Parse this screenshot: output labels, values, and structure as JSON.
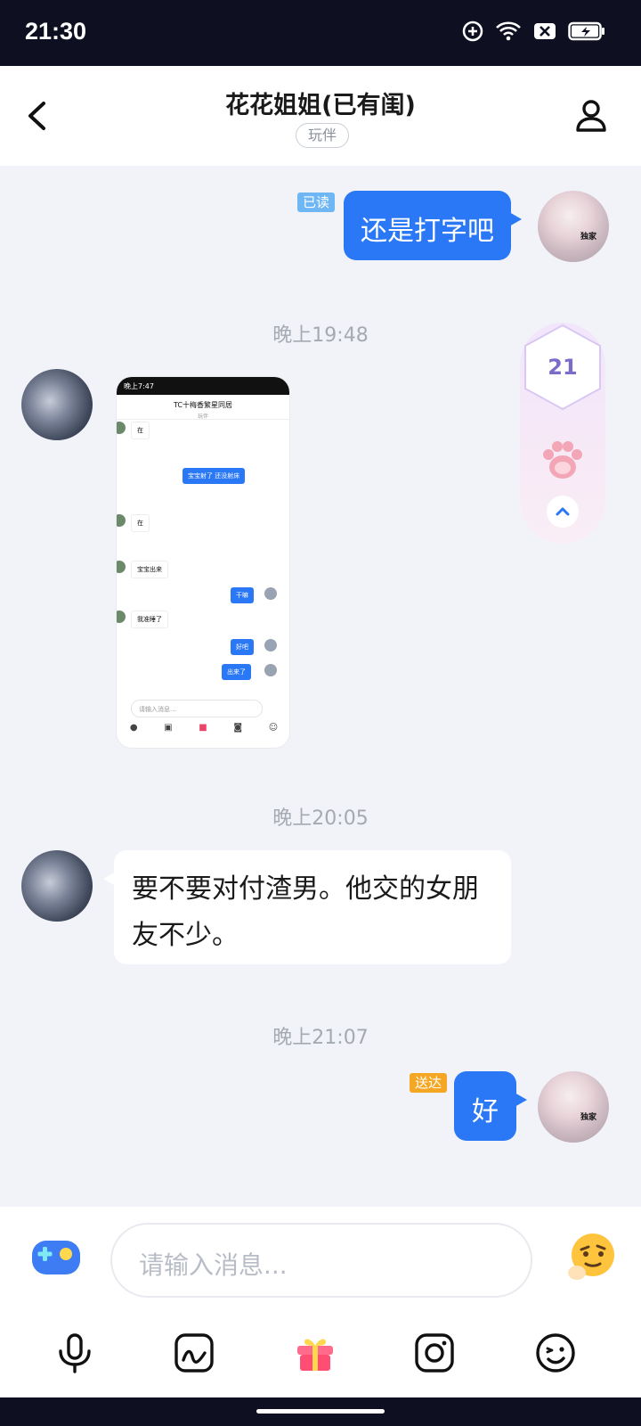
{
  "status_bar": {
    "time": "21:30",
    "icons": [
      "sync-icon",
      "wifi-icon",
      "sim-off-icon",
      "battery-charging-icon"
    ]
  },
  "header": {
    "title": "花花姐姐(已有闺)",
    "tag": "玩伴",
    "back_icon": "back-arrow-icon",
    "profile_icon": "person-icon"
  },
  "messages": [
    {
      "direction": "out",
      "text": "还是打字吧",
      "status": "已读"
    },
    {
      "timestamp": "晚上19:48"
    },
    {
      "direction": "in",
      "type": "image",
      "screenshot": {
        "status_time": "晚上7:47",
        "title": "TC十梅香繁星同居",
        "subtitle": "玩伴",
        "rows": [
          {
            "dir": "in",
            "text": "在"
          },
          {
            "dir": "out",
            "text": "宝宝射了 还没射床"
          },
          {
            "dir": "in",
            "text": "在"
          },
          {
            "dir": "in",
            "text": "宝宝出来"
          },
          {
            "dir": "out",
            "text": "干嘛"
          },
          {
            "dir": "in",
            "text": "我准睡了"
          },
          {
            "dir": "out",
            "text": "好吧"
          },
          {
            "dir": "out",
            "text": "出来了"
          }
        ],
        "input_placeholder": "请输入消息..."
      }
    },
    {
      "timestamp": "晚上20:05"
    },
    {
      "direction": "in",
      "text_line1": "要不要对付渣男。他交的女朋",
      "text_line2": "友不少。"
    },
    {
      "timestamp": "晚上21:07"
    },
    {
      "direction": "out",
      "text": "好",
      "status": "送达"
    }
  ],
  "widget": {
    "count": "21",
    "paw_icon": "paw-icon",
    "expand_icon": "chevron-up-icon"
  },
  "input": {
    "placeholder": "请输入消息...",
    "left_icon": "game-controller-icon",
    "right_icon": "emoji-face-icon"
  },
  "toolbar": {
    "tools": [
      "microphone-icon",
      "image-icon",
      "gift-icon",
      "camera-icon",
      "emoji-icon"
    ]
  },
  "colors": {
    "accent": "#2a78f6",
    "status_bar": "#0e1022",
    "chat_bg": "#f1f3f9",
    "read_badge": "#6fb6f5",
    "delivered_badge": "#f5a623",
    "widget_number": "#7c6cc9"
  }
}
